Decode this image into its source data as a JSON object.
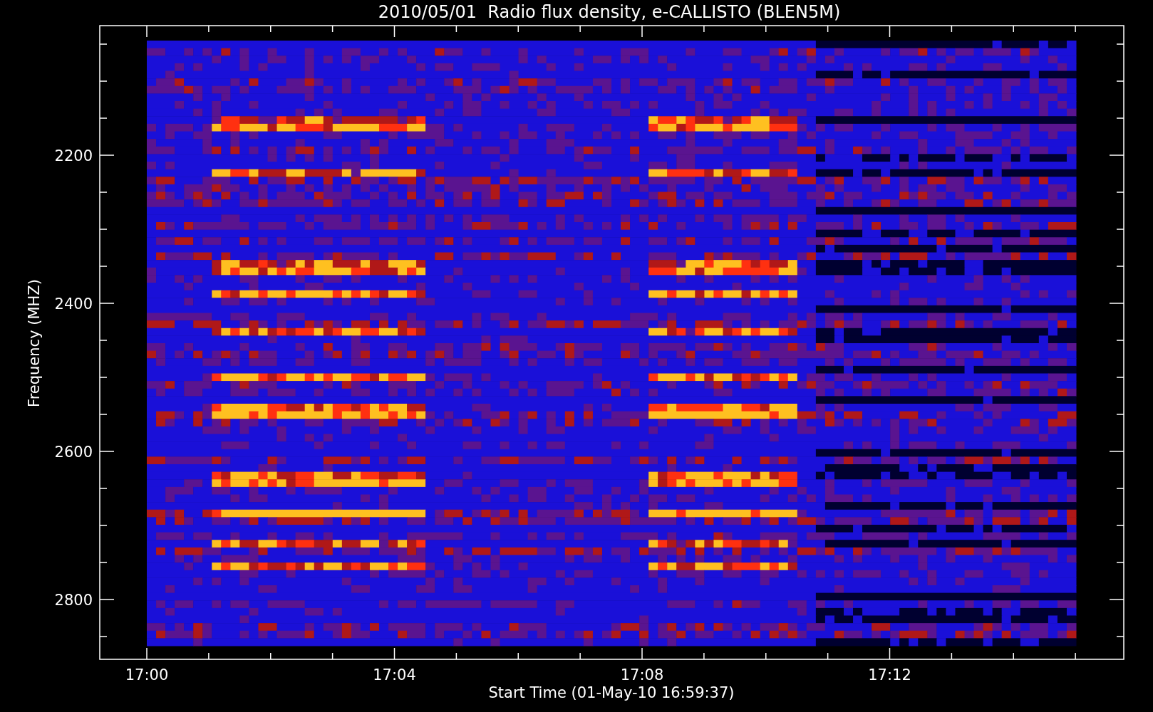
{
  "title": "2010/05/01  Radio flux density, e-CALLISTO (BLEN5M)",
  "y_axis": {
    "label": "Frequency (MHZ)",
    "ticks": [
      "2200",
      "2400",
      "2600",
      "2800"
    ]
  },
  "x_axis": {
    "label": "Start Time (01-May-10 16:59:37)",
    "ticks": [
      "17:00",
      "17:04",
      "17:08",
      "17:12"
    ]
  }
}
